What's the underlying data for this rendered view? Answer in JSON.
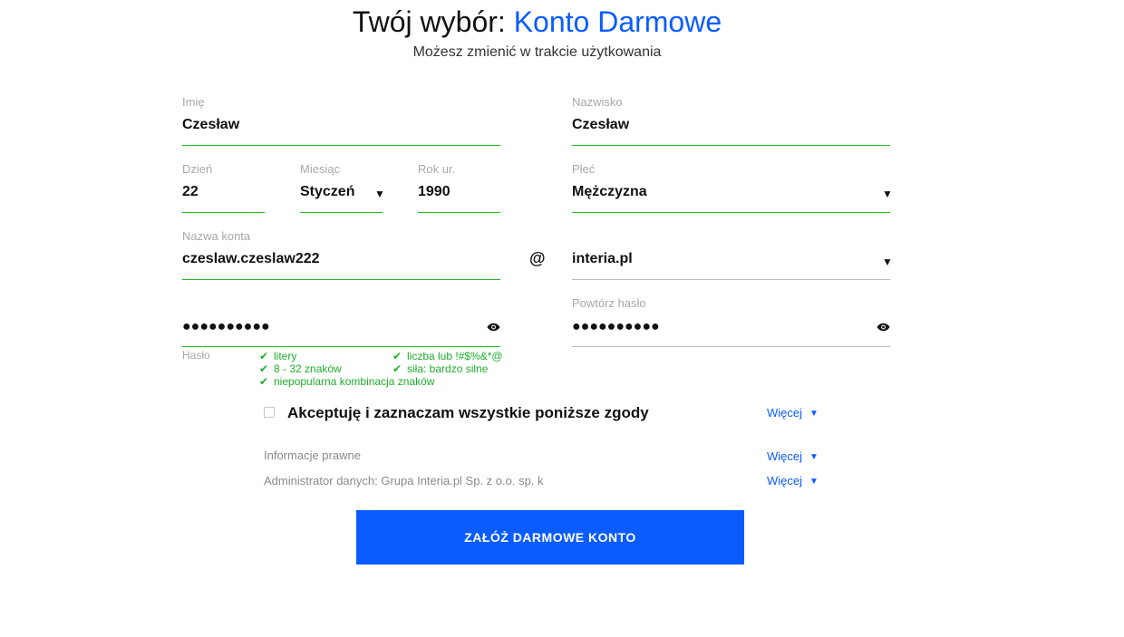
{
  "header": {
    "title_prefix": "Twój wybór: ",
    "title_accent": "Konto Darmowe",
    "subtitle": "Możesz zmienić w trakcie użytkowania"
  },
  "form": {
    "first_name": {
      "label": "Imię",
      "value": "Czesław"
    },
    "last_name": {
      "label": "Nazwisko",
      "value": "Czesław"
    },
    "day": {
      "label": "Dzień",
      "value": "22"
    },
    "month": {
      "label": "Miesiąc",
      "value": "Styczeń"
    },
    "year": {
      "label": "Rok ur.",
      "value": "1990"
    },
    "gender": {
      "label": "Płeć",
      "value": "Mężczyzna"
    },
    "account": {
      "label": "Nazwa konta",
      "value": "czeslaw.czeslaw222",
      "at": "@",
      "domain": "interia.pl"
    },
    "password": {
      "label": "Hasło",
      "masked": "●●●●●●●●●●"
    },
    "password_repeat": {
      "label": "Powtórz hasło",
      "masked": "●●●●●●●●●●"
    },
    "requirements": [
      "litery",
      "liczba lub !#$%&*@",
      "8 - 32 znaków",
      "siła: bardzo silne",
      "niepopularna kombinacja znaków"
    ],
    "check_glyph": "✔",
    "caret_glyph": "▼"
  },
  "consents": {
    "accept_all": "Akceptuję i zaznaczam wszystkie poniższe zgody",
    "legal_info": "Informacje prawne",
    "admin": "Administrator danych: Grupa Interia.pl Sp. z o.o. sp. k",
    "more_label": "Więcej",
    "more_caret": "▼"
  },
  "cta": {
    "label": "ZAŁÓŻ DARMOWE KONTO"
  },
  "colors": {
    "accent": "#0a5cff",
    "valid": "#29b829",
    "muted": "#a8a8a8"
  },
  "icons": [
    "eye-icon",
    "checkmark-icon",
    "caret-down-icon",
    "checkbox"
  ]
}
